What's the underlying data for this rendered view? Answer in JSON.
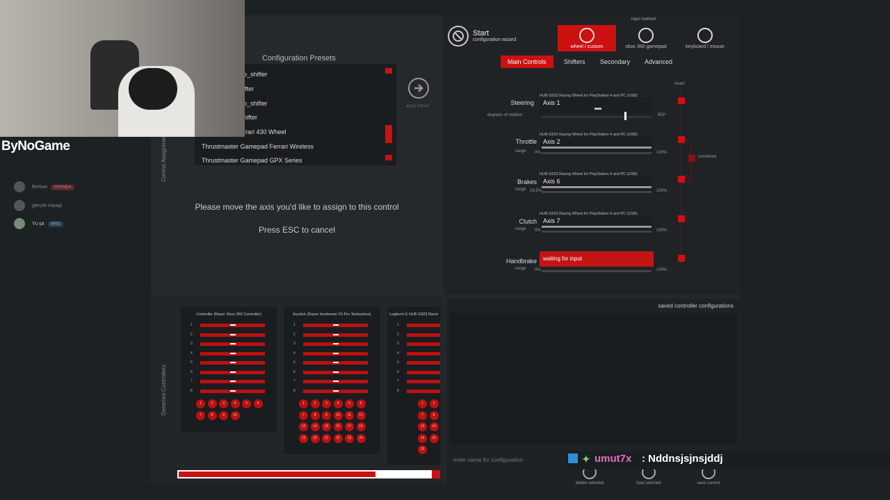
{
  "presets": {
    "title": "Configuration Presets",
    "items": [
      "o_shifter",
      "ifter",
      "o_shifter",
      "hifter",
      "rrari 430 Wheel",
      "Thrustmaster Gamepad Ferrari Wireless",
      "Thrustmaster Gamepad GPX Series"
    ],
    "apply_label": "apply preset",
    "side_label": "Control Assignment"
  },
  "prompt": {
    "line1": "Please move the axis you'd like to assign to this control",
    "line2": "Press ESC to cancel"
  },
  "wizard": {
    "title": "Start",
    "subtitle": "configuration wizard",
    "input_method_label": "input method",
    "modes": [
      "wheel / custom",
      "xbox 360 gamepad",
      "keyboard / mouse"
    ]
  },
  "tabs": [
    "Main Controls",
    "Shifters",
    "Secondary",
    "Advanced"
  ],
  "invert_label": "invert",
  "combined_label": "combined",
  "controls": [
    {
      "label": "Steering",
      "device": "HUB G923 Racing Wheel for PlayStation 4 and PC (USB)",
      "axis": "Axis 1",
      "sub_label": "degrees of rotation",
      "min": "",
      "max": "902°"
    },
    {
      "label": "Throttle",
      "device": "HUB G923 Racing Wheel for PlayStation 4 and PC (USB)",
      "axis": "Axis 2",
      "sub_label": "range",
      "min": "0%",
      "max": "100%"
    },
    {
      "label": "Brakes",
      "device": "HUB G923 Racing Wheel for PlayStation 4 and PC (USB)",
      "axis": "Axis 6",
      "sub_label": "range",
      "min": "19.5%",
      "max": "100%"
    },
    {
      "label": "Clutch",
      "device": "HUB G923 Racing Wheel for PlayStation 4 and PC (USB)",
      "axis": "Axis 7",
      "sub_label": "range",
      "min": "0%",
      "max": "100%"
    },
    {
      "label": "Handbrake",
      "device": "",
      "axis": "waiting for input",
      "sub_label": "range",
      "min": "0%",
      "max": "100%"
    }
  ],
  "detected": {
    "side_label": "Detected Controllers",
    "controllers": [
      {
        "title": "Controller (Razer Xbox 360 Controller)",
        "axes": [
          "1",
          "2",
          "3",
          "4",
          "5",
          "6",
          "7",
          "8"
        ],
        "buttons": [
          "1",
          "2",
          "3",
          "4",
          "5",
          "6",
          "7",
          "8",
          "9",
          "10"
        ]
      },
      {
        "title": "Joystick (Razer Huntsman V3 Pro Tenkeyless)",
        "axes": [
          "1",
          "2",
          "3",
          "4",
          "5",
          "6",
          "7",
          "8"
        ],
        "buttons": [
          "1",
          "2",
          "3",
          "4",
          "5",
          "6",
          "7",
          "8",
          "9",
          "10",
          "11",
          "12",
          "13",
          "14",
          "15",
          "16",
          "17",
          "18",
          "19",
          "20",
          "21",
          "22",
          "23",
          "24"
        ]
      },
      {
        "title": "Logitech G HUB G923 Racin",
        "axes": [
          "1",
          "2",
          "3",
          "4",
          "5",
          "6",
          "7",
          "8"
        ],
        "buttons": [
          "1",
          "2",
          "7",
          "8",
          "13",
          "14",
          "19",
          "20",
          "25"
        ]
      }
    ]
  },
  "saved": {
    "title": "saved controller configurations",
    "placeholder": "enter name for configuration",
    "actions": [
      "delete selected",
      "load selected",
      "save current"
    ]
  },
  "stream": {
    "logo": "ByNoGame",
    "viewers": [
      {
        "name": "Berkan",
        "badge": "YAYINDA"
      },
      {
        "name": "gerçek miyagi",
        "badge": ""
      },
      {
        "name": "Yu şa",
        "badge": "VİYU"
      }
    ],
    "chat_user": "umut7x",
    "chat_message": ": Nddnsjsjnsjddj"
  },
  "colors": {
    "accent": "#cc1111",
    "panel": "#23282b"
  }
}
